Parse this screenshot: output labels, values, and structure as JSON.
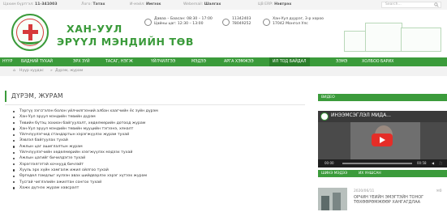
{
  "topbar": {
    "phone_label": "Цахим бүртгэл:",
    "phone_value": "11-341003",
    "email_label": "Лого:",
    "email_value": "Татах",
    "mail_label": "И-мэйл:",
    "mail_value": "Имгэзк",
    "webmail_label": "Webemail:",
    "webmail_value": "Шалгах",
    "erp_label": "ЦВ ERP:",
    "erp_value": "Нэвтрэх",
    "search_placeholder": "Search..."
  },
  "header": {
    "brand_line1": "ХАН-УУЛ",
    "brand_line2": "ЭРҮҮЛ МЭНДИЙН ТӨВ",
    "hours_line1": "Даваа – Баасан: 08:30 – 17:00",
    "hours_line2": "Цайны цаг: 12:30 – 13:00",
    "phone1": "11342403",
    "phone2": "78049252",
    "address_line1": "Хан-Уул дүүрэг, 3-р хороо",
    "address_line2": "17042 Монгол Улс"
  },
  "nav": {
    "items": [
      "НҮҮР",
      "БИДНИЙ ТУХАЙ",
      "ЭРХ ЗҮЙ",
      "ТАСАГ, НЭГЖ",
      "ҮЙЛЧИЛГЭЭ",
      "МЭДЭЭ",
      "АРГА ХЭМЖЭЭ",
      "ИЛ ТОД БАЙДАЛ",
      "ЭЭМЭ",
      "ХОЛБОО БАРИХ"
    ],
    "active_index": 7
  },
  "breadcrumb": {
    "home": "Нүүр хуудас",
    "separator": "»",
    "current": "Дүрэм, журам"
  },
  "article": {
    "title": "ДҮРЭМ, ЖУРАМ",
    "items": [
      "Тэргүү зэгсгэлэн болон үйлчилгээний албан хаагчийн ёс зүйн дүрэм",
      "Хан-Уул эрүүл мэндийн төвийн дүрэм",
      "Төвийн бүтэц зохион байгуулалт, хөдөлмөрийн дотоод журам",
      "Хан-Уул эрүүл мэндийн төвийн мууцийн тэгээнэ, хяналт",
      "Үйлчлүүлэгчид стандартын хэрэгжүүлэх журам тухай",
      "Ээвлэл байгуулах тухай",
      "Ажлын цаг ашиглалтын журам",
      "Үйлчлүүлэгчийн хөдөлмөрийн хээгжүүлэх мэдээх тухай",
      "Ажлын цагийг бичилдэгээ тухай",
      "Хэрэглэлгэтэй хочнууд бичлэйт",
      "Хүүль эрх хүйн хамгалж ижил ойлгоо тухай",
      "Өргөдөл гомдлыг хүлээн авах шийдвэрлэх хэрэг хүтээх журам",
      "Тусгай чиглэлийн ажилтан сонгох тухай",
      "Хажх дүгнэх журам хавсралт"
    ]
  },
  "sidebar": {
    "video_heading": "ВИДЕО",
    "video_title": "ИНЭЭМСЭГЛЭЛ МИДА...",
    "video_time_start": "00:00",
    "video_time_end": "00:58",
    "tabs": [
      "ШИНЭ МЭДЭЭ",
      "ИХ УНШСАН"
    ],
    "news": {
      "date": "2020/06/11",
      "count": "0",
      "title": "ОРЧИН ҮЕИЙН ЭМЭГТЭЙН ТОНОГ ТӨХӨӨРӨМЖӨӨР ХАНГАГДЛАА"
    }
  },
  "colors": {
    "brand_green": "#3b9b3b",
    "active_green": "#2a7e2a",
    "cross_red": "#d63a3a"
  }
}
